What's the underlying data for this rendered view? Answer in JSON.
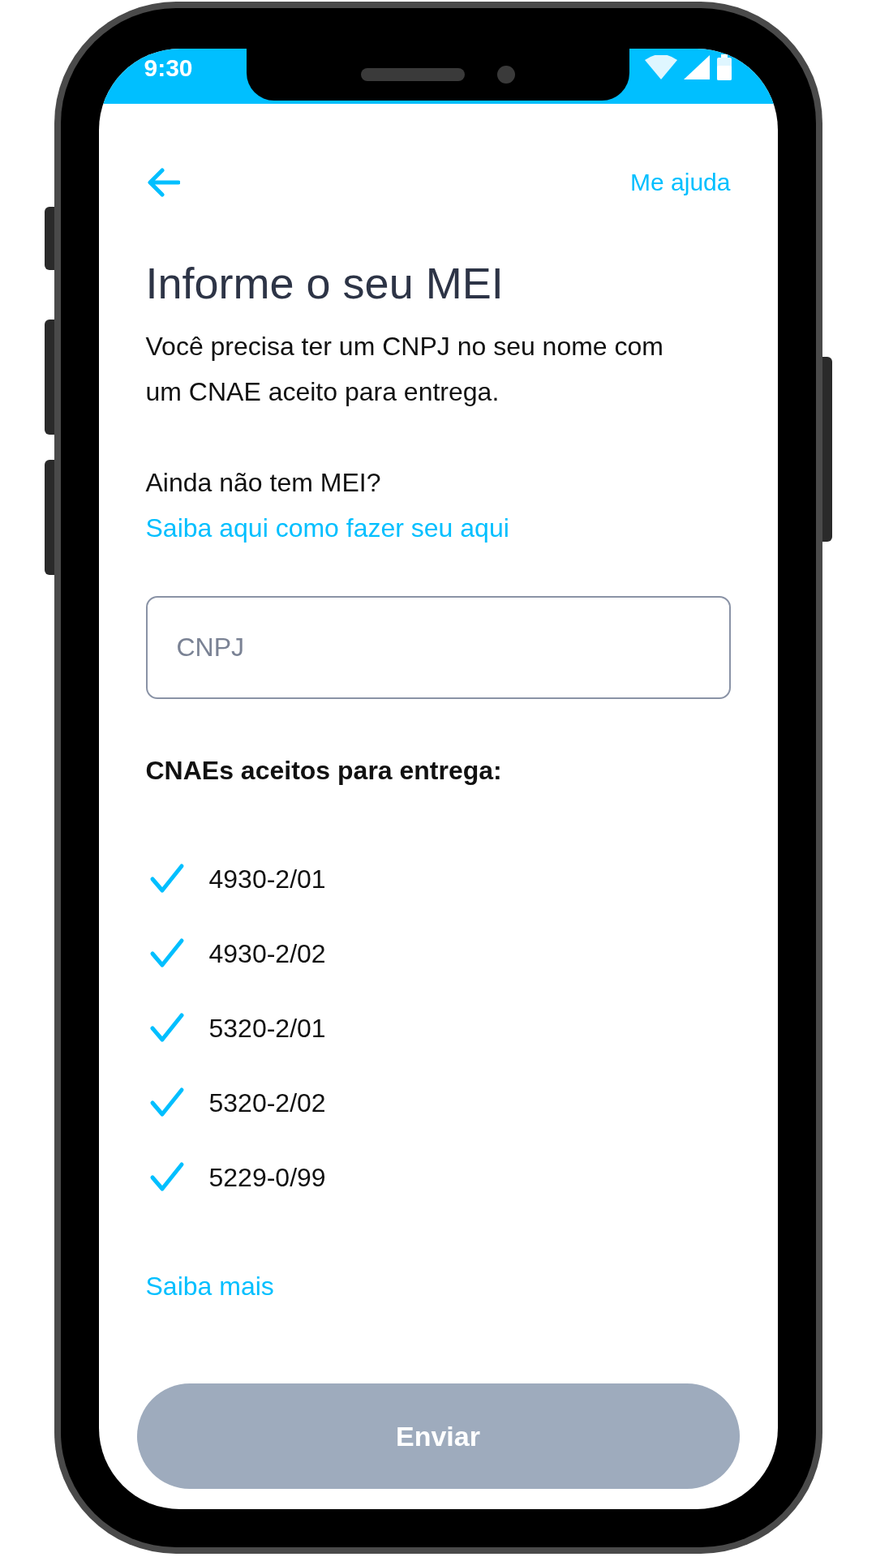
{
  "status_bar": {
    "time": "9:30"
  },
  "header": {
    "help_link": "Me ajuda"
  },
  "title": "Informe o seu MEI",
  "description": "Você precisa ter um CNPJ no seu nome com um CNAE aceito para entrega.",
  "prompt": {
    "text": "Ainda não tem MEI?",
    "link": "Saiba aqui como fazer seu aqui"
  },
  "cnpj_field": {
    "placeholder": "CNPJ"
  },
  "section_title": "CNAEs aceitos para entrega:",
  "cnaes": [
    {
      "code": "4930-2/01",
      "checked": true
    },
    {
      "code": "4930-2/02",
      "checked": true
    },
    {
      "code": "5320-2/01",
      "checked": true
    },
    {
      "code": "5320-2/02",
      "checked": true
    },
    {
      "code": "5229-0/99",
      "checked": true
    }
  ],
  "more_link": "Saiba mais",
  "submit_button": {
    "label": "Enviar",
    "disabled": true
  }
}
